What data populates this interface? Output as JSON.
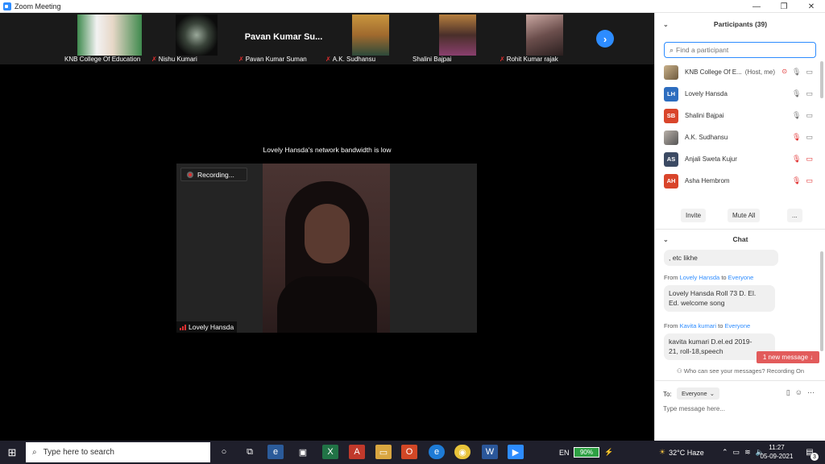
{
  "window": {
    "title": "Zoom Meeting",
    "controls": [
      "—",
      "❐",
      "✕"
    ]
  },
  "gallery": {
    "tiles": [
      {
        "name": "KNB College Of Education",
        "muted": false
      },
      {
        "name": "Nishu Kumari",
        "muted": true
      },
      {
        "name": "Pavan Kumar Suman",
        "big_label": "Pavan Kumar Su...",
        "muted": true
      },
      {
        "name": "A.K. Sudhansu",
        "muted": true
      },
      {
        "name": "Shalini Bajpai",
        "muted": false
      },
      {
        "name": "Rohit Kumar rajak",
        "muted": true
      }
    ],
    "next_icon": "›"
  },
  "main": {
    "bandwidth_notice": "Lovely Hansda's network bandwidth is low",
    "recording_label": "Recording...",
    "speaker_name": "Lovely Hansda"
  },
  "participants": {
    "title": "Participants (39)",
    "search_placeholder": "Find a participant",
    "list": [
      {
        "name": "KNB College Of E...",
        "role": "(Host, me)",
        "avatar": "",
        "avatar_color": ""
      },
      {
        "name": "Lovely Hansda",
        "role": "",
        "avatar": "LH",
        "avatar_color": "#2d6dbf"
      },
      {
        "name": "Shalini Bajpai",
        "role": "",
        "avatar": "SB",
        "avatar_color": "#d9452b"
      },
      {
        "name": "A.K. Sudhansu",
        "role": "",
        "avatar": "",
        "avatar_color": ""
      },
      {
        "name": "Anjali Sweta Kujur",
        "role": "",
        "avatar": "AS",
        "avatar_color": "#3b4a63"
      },
      {
        "name": "Asha Hembrom",
        "role": "",
        "avatar": "AH",
        "avatar_color": "#d9452b"
      }
    ],
    "buttons": {
      "invite": "Invite",
      "mute_all": "Mute All",
      "more": "..."
    }
  },
  "chat": {
    "title": "Chat",
    "messages": [
      {
        "from": "",
        "to": "",
        "text": ", etc likhe"
      },
      {
        "from": "Lovely Hansda",
        "to": "Everyone",
        "text_lines": [
          "Lovely Hansda Roll 73 D. El.",
          "Ed. welcome song"
        ]
      },
      {
        "from": "Kavita kumari",
        "to": "Everyone",
        "text_lines": [
          "kavita kumari D.el.ed 2019-",
          "21, roll-18,speech"
        ]
      }
    ],
    "from_word": "From",
    "to_word": "to",
    "new_message": "1 new message ↓",
    "who_can_see": "Who can see your messages? Recording On",
    "to_label": "To:",
    "to_value": "Everyone",
    "input_placeholder": "Type message here..."
  },
  "taskbar": {
    "search_placeholder": "Type here to search",
    "language": "EN",
    "battery": "90%",
    "weather": "32°C  Haze",
    "time": "11:27",
    "date": "05-09-2021",
    "notifications": "3"
  }
}
